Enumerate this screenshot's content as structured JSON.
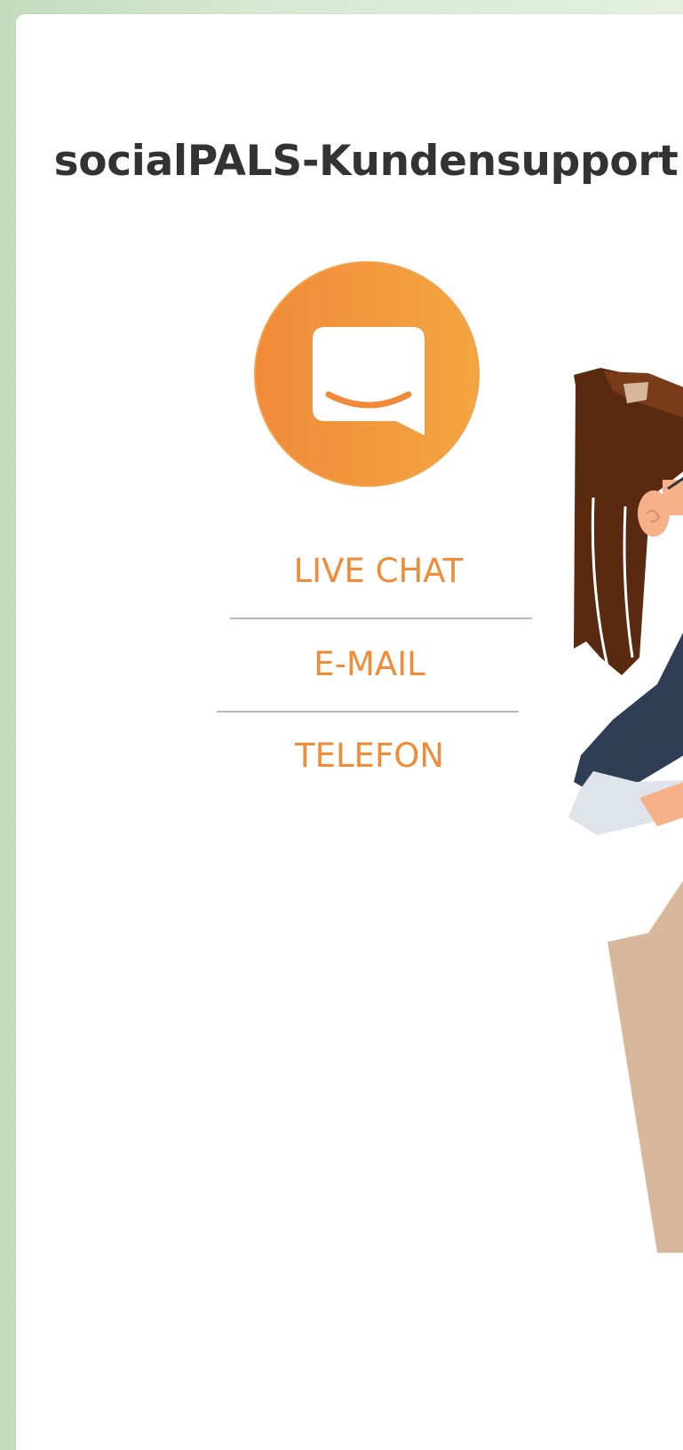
{
  "page": {
    "title": "socialPALS-Kundensupport"
  },
  "contact_options": [
    {
      "label": "LIVE CHAT"
    },
    {
      "label": "E-MAIL"
    },
    {
      "label": "TELEFON"
    }
  ],
  "icons": {
    "badge": "chat-bubble-smile-icon",
    "illustration": "support-agent-illustration"
  },
  "colors": {
    "accent": "#ee8c3a",
    "badge_start": "#f08a3a",
    "badge_end": "#f3a640",
    "title": "#333333",
    "divider": "#b9b9b9",
    "page_bg": "#d7e9d2",
    "card_bg": "#ffffff"
  }
}
